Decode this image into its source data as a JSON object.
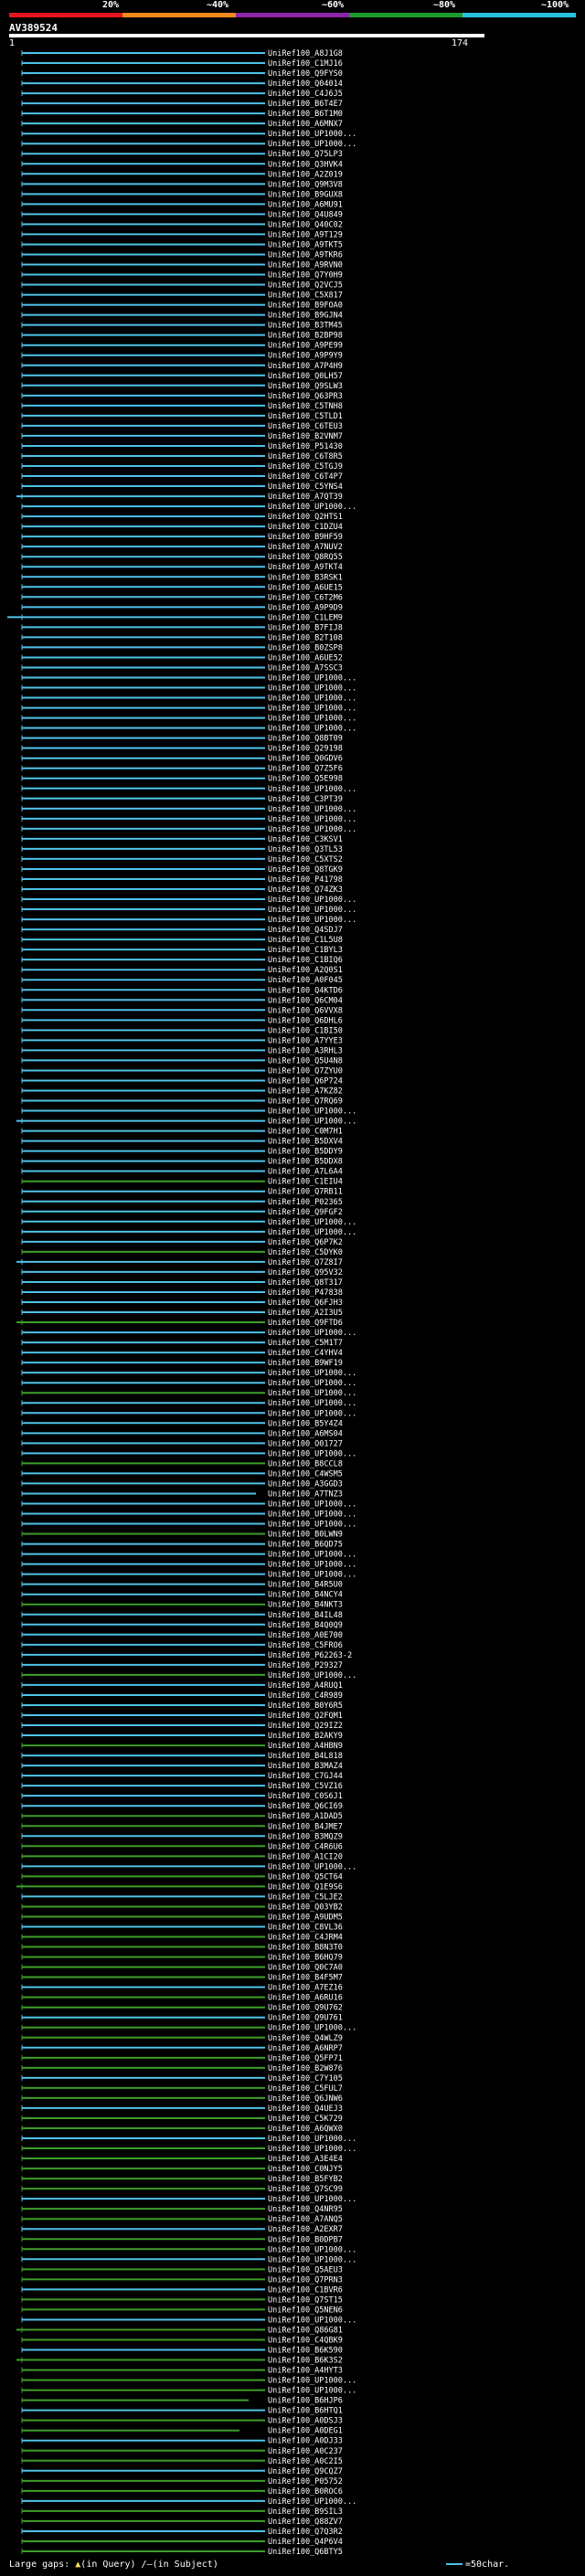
{
  "scale": {
    "labels": [
      "20%",
      "~40%",
      "~60%",
      "~80%",
      "~100%"
    ],
    "colors": [
      "#e8141b",
      "#f08a1c",
      "#8e24aa",
      "#1e9c2a",
      "#29c3e0"
    ]
  },
  "query": {
    "id": "AV389524",
    "start": "1",
    "end": "174"
  },
  "colors": {
    "cyan": "#4fc3e8",
    "green": "#3f9e2a",
    "background": "#000000"
  },
  "hits": [
    "UniRef100_A8J1G8",
    "UniRef100_C1MJ16",
    "UniRef100_Q9FYS0",
    "UniRef100_Q04014",
    "UniRef100_C4J6J5",
    "UniRef100_B6T4E7",
    "UniRef100_B6T1M0",
    "UniRef100_A6MNX7",
    "UniRef100_UP1000...",
    "UniRef100_UP1000...",
    "UniRef100_Q75LP3",
    "UniRef100_Q3HVK4",
    "UniRef100_A2Z019",
    "UniRef100_Q9M3V8",
    "UniRef100_B9GUX8",
    "UniRef100_A6MU91",
    "UniRef100_Q4U849",
    "UniRef100_Q40C02",
    "UniRef100_A9T129",
    "UniRef100_A9TKT5",
    "UniRef100_A9TKR6",
    "UniRef100_A9RVN0",
    "UniRef100_Q7Y0H9",
    "UniRef100_Q2VCJ5",
    "UniRef100_C5X817",
    "UniRef100_B9FOA0",
    "UniRef100_B9GJN4",
    "UniRef100_B3TM45",
    "UniRef100_B2BP98",
    "UniRef100_A9PE99",
    "UniRef100_A9P9Y9",
    "UniRef100_A7P4H9",
    "UniRef100_Q0LH57",
    "UniRef100_Q9SLW3",
    "UniRef100_Q63PR3",
    "UniRef100_C5TNH8",
    "UniRef100_C5TLD1",
    "UniRef100_C6TEU3",
    "UniRef100_B2VNM7",
    "UniRef100_P51430",
    "UniRef100_C6T8R5",
    "UniRef100_C5TGJ9",
    "UniRef100_C6T4P7",
    "UniRef100_C5YNS4",
    "UniRef100_A7QT39",
    "UniRef100_UP1000...",
    "UniRef100_Q2HTS1",
    "UniRef100_C1DZU4",
    "UniRef100_B9HF59",
    "UniRef100_A7NUV2",
    "UniRef100_Q8RQ55",
    "UniRef100_A9TKT4",
    "UniRef100_B3RSK1",
    "UniRef100_A6UE15",
    "UniRef100_C6T2M6",
    "UniRef100_A9P9D9",
    "UniRef100_C1LEM9",
    "UniRef100_B7FIJ8",
    "UniRef100_B2T108",
    "UniRef100_B0ZSP8",
    "UniRef100_A6UE52",
    "UniRef100_A7SSC3",
    "UniRef100_UP1000...",
    "UniRef100_UP1000...",
    "UniRef100_UP1000...",
    "UniRef100_UP1000...",
    "UniRef100_UP1000...",
    "UniRef100_UP1000...",
    "UniRef100_Q8BT09",
    "UniRef100_Q29198",
    "UniRef100_Q0GDV6",
    "UniRef100_Q7Z5F6",
    "UniRef100_Q5E998",
    "UniRef100_UP1000...",
    "UniRef100_C3PT39",
    "UniRef100_UP1000...",
    "UniRef100_UP1000...",
    "UniRef100_UP1000...",
    "UniRef100_C3KSV1",
    "UniRef100_Q3TL53",
    "UniRef100_C5XTS2",
    "UniRef100_Q8TGK9",
    "UniRef100_P41798",
    "UniRef100_Q74ZK3",
    "UniRef100_UP1000...",
    "UniRef100_UP1000...",
    "UniRef100_UP1000...",
    "UniRef100_Q4SDJ7",
    "UniRef100_C1L5U8",
    "UniRef100_C1BYL3",
    "UniRef100_C1BIQ6",
    "UniRef100_A2Q0S1",
    "UniRef100_A0F045",
    "UniRef100_Q4KTD6",
    "UniRef100_Q6CM04",
    "UniRef100_Q6VVX8",
    "UniRef100_Q6DHL6",
    "UniRef100_C1BI50",
    "UniRef100_A7YYE3",
    "UniRef100_A3RHL3",
    "UniRef100_Q5U4N8",
    "UniRef100_Q7ZYU0",
    "UniRef100_Q6P724",
    "UniRef100_A7KZ82",
    "UniRef100_Q7RQ69",
    "UniRef100_UP1000...",
    "UniRef100_UP1000...",
    "UniRef100_C0M7H1",
    "UniRef100_B5DXV4",
    "UniRef100_B5DDY9",
    "UniRef100_B5DDX8",
    "UniRef100_A7L6A4",
    "UniRef100_C1EIU4",
    "UniRef100_Q7RB11",
    "UniRef100_P02365",
    "UniRef100_Q9FGF2",
    "UniRef100_UP1000...",
    "UniRef100_UP1000...",
    "UniRef100_Q6P7K2",
    "UniRef100_C5DYK0",
    "UniRef100_Q7Z8I7",
    "UniRef100_Q95V32",
    "UniRef100_Q8T317",
    "UniRef100_P47838",
    "UniRef100_Q6FJH3",
    "UniRef100_A2I3U5",
    "UniRef100_Q9FTD6",
    "UniRef100_UP1000...",
    "UniRef100_C5M1T7",
    "UniRef100_C4YHV4",
    "UniRef100_B9WF19",
    "UniRef100_UP1000...",
    "UniRef100_UP1000...",
    "UniRef100_UP1000...",
    "UniRef100_UP1000...",
    "UniRef100_UP1000...",
    "UniRef100_B5Y4Z4",
    "UniRef100_A6MS04",
    "UniRef100_O01727",
    "UniRef100_UP1000...",
    "UniRef100_B8CCL8",
    "UniRef100_C4WSM5",
    "UniRef100_A3GGD3",
    "UniRef100_A7TNZ3",
    "UniRef100_UP1000...",
    "UniRef100_UP1000...",
    "UniRef100_UP1000...",
    "UniRef100_B0LWN9",
    "UniRef100_B6QD75",
    "UniRef100_UP1000...",
    "UniRef100_UP1000...",
    "UniRef100_UP1000...",
    "UniRef100_B4R5U0",
    "UniRef100_B4NCY4",
    "UniRef100_B4NKT3",
    "UniRef100_B4IL48",
    "UniRef100_B4Q0Q9",
    "UniRef100_A0E700",
    "UniRef100_C5FRO6",
    "UniRef100_P62263-2",
    "UniRef100_P29327",
    "UniRef100_UP1000...",
    "UniRef100_A4RUQ1",
    "UniRef100_C4R989",
    "UniRef100_B0Y6R5",
    "UniRef100_Q2FQM1",
    "UniRef100_Q29IZ2",
    "UniRef100_B2AKY9",
    "UniRef100_A4HBN9",
    "UniRef100_B4L818",
    "UniRef100_B3MAZ4",
    "UniRef100_C7GJ44",
    "UniRef100_C5VZ16",
    "UniRef100_C0S6J1",
    "UniRef100_Q6CI69",
    "UniRef100_A1DAD5",
    "UniRef100_B4JME7",
    "UniRef100_B3MQZ9",
    "UniRef100_C4R6U6",
    "UniRef100_A1CI20",
    "UniRef100_UP1000...",
    "UniRef100_Q5CT64",
    "UniRef100_Q1E9S6",
    "UniRef100_C5LJE2",
    "UniRef100_Q03YB2",
    "UniRef100_A9UDM5",
    "UniRef100_C8VL36",
    "UniRef100_C4JRM4",
    "UniRef100_B8N3T0",
    "UniRef100_B6HQ79",
    "UniRef100_Q0C7A0",
    "UniRef100_B4F5M7",
    "UniRef100_A7EZ16",
    "UniRef100_A6RU16",
    "UniRef100_Q9U762",
    "UniRef100_Q9U761",
    "UniRef100_UP1000...",
    "UniRef100_Q4WLZ9",
    "UniRef100_A6NRP7",
    "UniRef100_Q5FP71",
    "UniRef100_B2W876",
    "UniRef100_C7Y105",
    "UniRef100_C5FUL7",
    "UniRef100_Q6JNW6",
    "UniRef100_Q4UEJ3",
    "UniRef100_C5K729",
    "UniRef100_A6QWX0",
    "UniRef100_UP1000...",
    "UniRef100_UP1000...",
    "UniRef100_A3E4E4",
    "UniRef100_C0NJY5",
    "UniRef100_B5FYB2",
    "UniRef100_Q7SC99",
    "UniRef100_UP1000...",
    "UniRef100_Q4NR95",
    "UniRef100_A7ANQ5",
    "UniRef100_A2EXR7",
    "UniRef100_B0DPB7",
    "UniRef100_UP1000...",
    "UniRef100_UP1000...",
    "UniRef100_Q5AEU3",
    "UniRef100_Q7PRN3",
    "UniRef100_C1BVR6",
    "UniRef100_Q7ST15",
    "UniRef100_Q5NEN6",
    "UniRef100_UP1000...",
    "UniRef100_Q86G81",
    "UniRef100_C4QBK9",
    "UniRef100_B6K590",
    "UniRef100_B6K3S2",
    "UniRef100_A4HYT3",
    "UniRef100_UP1000...",
    "UniRef100_UP1000...",
    "UniRef100_B6HJP6",
    "UniRef100_B6HTQ1",
    "UniRef100_A0DSJ3",
    "UniRef100_A0DEG1",
    "UniRef100_A0DJ33",
    "UniRef100_A0C237",
    "UniRef100_A0C2I5",
    "UniRef100_Q9CQZ7",
    "UniRef100_P05752",
    "UniRef100_B0ROC6",
    "UniRef100_UP1000...",
    "UniRef100_B9SIL3",
    "UniRef100_Q88ZV7",
    "UniRef100_Q7Q3R2",
    "UniRef100_Q4P6V4",
    "UniRef100_Q6BTY5"
  ],
  "footer": {
    "gaps_label": "Large gaps:",
    "in_query": "(in Query)",
    "in_subject": "(in Subject)",
    "scale_label": "=50char."
  }
}
